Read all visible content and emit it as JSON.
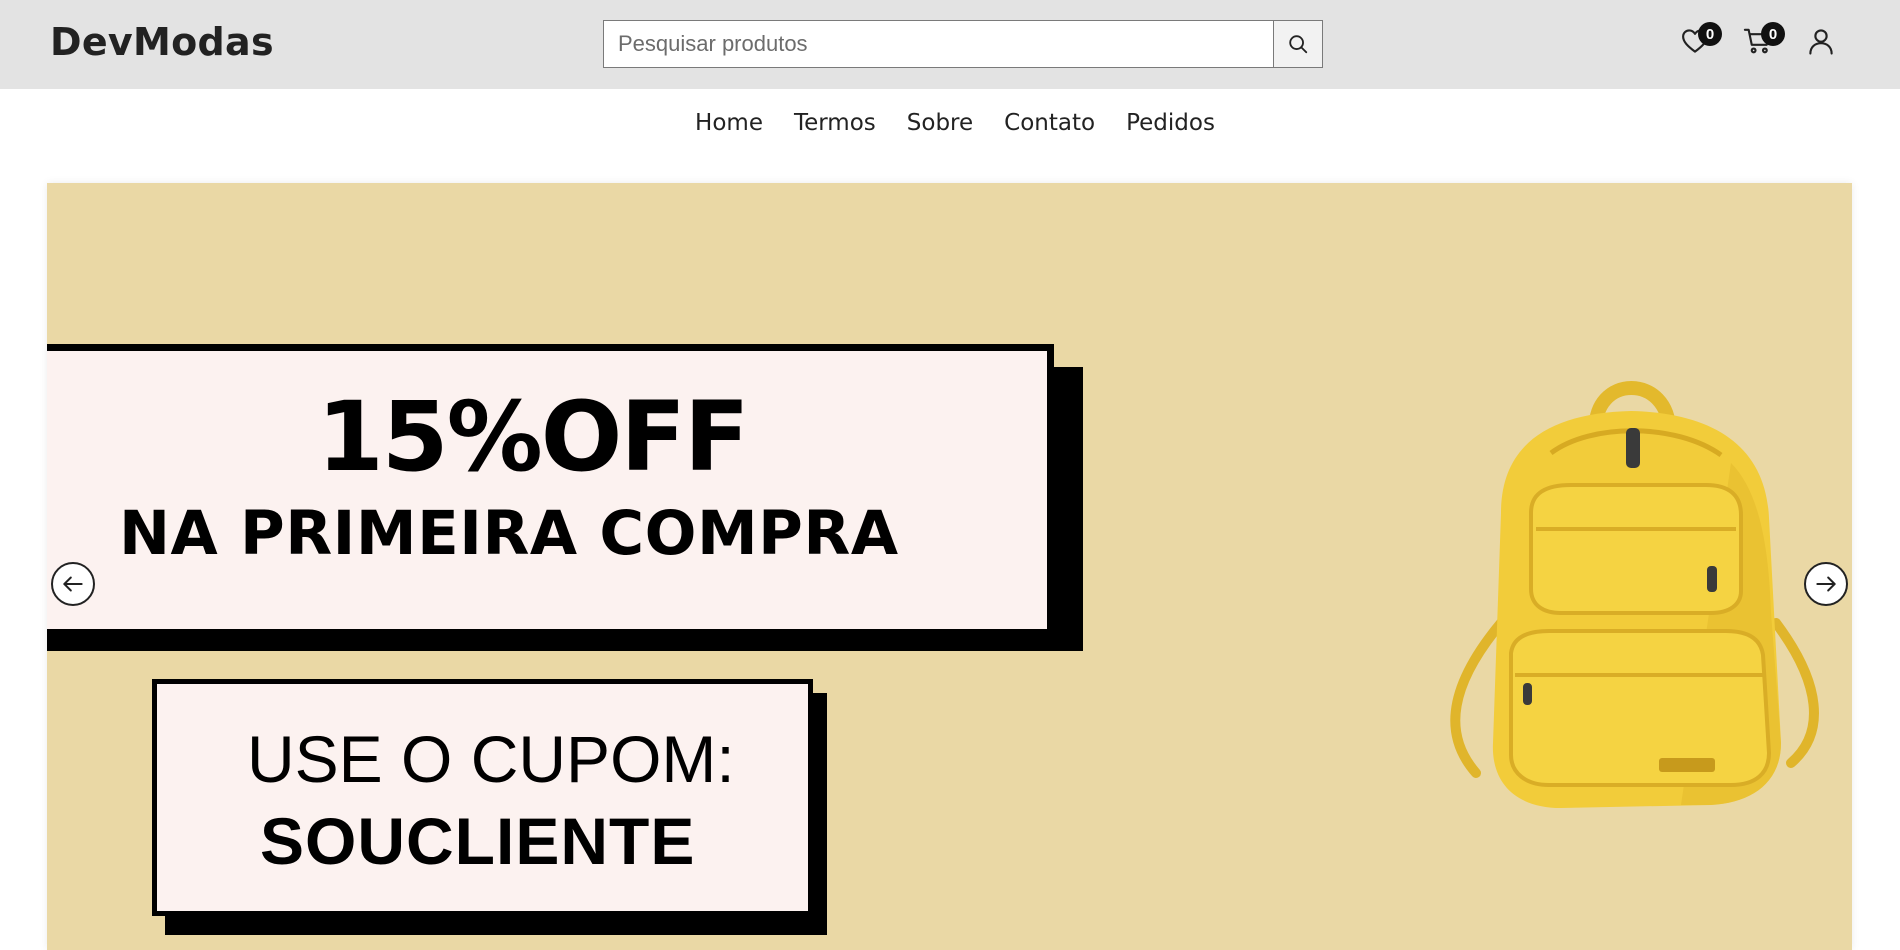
{
  "header": {
    "logo": "DevModas",
    "search": {
      "placeholder": "Pesquisar produtos",
      "value": ""
    },
    "wishlist_count": "0",
    "cart_count": "0"
  },
  "nav": {
    "items": [
      {
        "label": "Home"
      },
      {
        "label": "Termos"
      },
      {
        "label": "Sobre"
      },
      {
        "label": "Contato"
      },
      {
        "label": "Pedidos"
      }
    ]
  },
  "banner": {
    "headline": "15%OFF",
    "subheadline": "NA PRIMEIRA COMPRA",
    "coupon_label": "USE O CUPOM:",
    "coupon_code": "SOUCLIENTE",
    "background_color": "#ead8a5",
    "product_icon": "yellow-backpack"
  },
  "colors": {
    "header_bg": "#e3e3e3",
    "badge_bg": "#111111",
    "backpack": "#f2cc3a"
  }
}
